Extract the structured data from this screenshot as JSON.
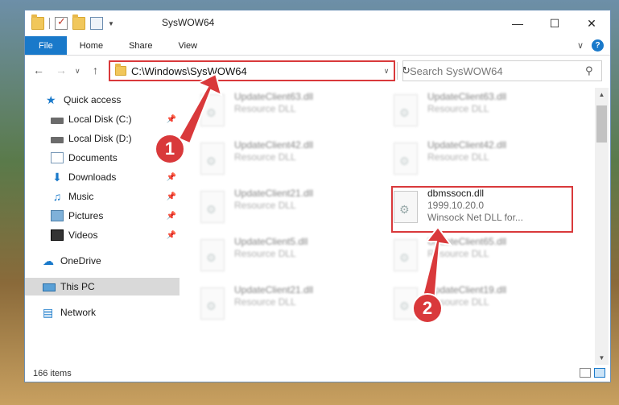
{
  "window": {
    "title": "SysWOW64"
  },
  "ribbon": {
    "tabs": [
      "File",
      "Home",
      "Share",
      "View"
    ]
  },
  "address": {
    "path": "C:\\Windows\\SysWOW64"
  },
  "search": {
    "placeholder": "Search SysWOW64"
  },
  "nav": {
    "items": [
      {
        "label": "Quick access",
        "icon": "star-icon"
      },
      {
        "label": "Local Disk (C:)",
        "icon": "drive-icon",
        "pinned": true
      },
      {
        "label": "Local Disk (D:)",
        "icon": "drive-icon"
      },
      {
        "label": "Documents",
        "icon": "documents-icon",
        "pinned": true
      },
      {
        "label": "Downloads",
        "icon": "download-icon",
        "pinned": true
      },
      {
        "label": "Music",
        "icon": "music-icon",
        "pinned": true
      },
      {
        "label": "Pictures",
        "icon": "pictures-icon",
        "pinned": true
      },
      {
        "label": "Videos",
        "icon": "videos-icon",
        "pinned": true
      },
      {
        "label": "OneDrive",
        "icon": "cloud-icon"
      },
      {
        "label": "This PC",
        "icon": "computer-icon",
        "selected": true
      },
      {
        "label": "Network",
        "icon": "network-icon"
      }
    ]
  },
  "files": [
    {
      "name": "UpdateClient63.dll",
      "meta": "Resource DLL"
    },
    {
      "name": "UpdateClient63.dll",
      "meta": "Resource DLL"
    },
    {
      "name": "UpdateClient42.dll",
      "meta": "Resource DLL"
    },
    {
      "name": "UpdateClient42.dll",
      "meta": "Resource DLL"
    },
    {
      "name": "UpdateClient21.dll",
      "meta": "Resource DLL"
    },
    {
      "name": "dbmssocn.dll",
      "meta": "1999.10.20.0",
      "meta2": "Winsock Net DLL for..."
    },
    {
      "name": "UpdateClient5.dll",
      "meta": "Resource DLL"
    },
    {
      "name": "UpdateClient65.dll",
      "meta": "Resource DLL"
    },
    {
      "name": "UpdateClient21.dll",
      "meta": "Resource DLL"
    },
    {
      "name": "UpdateClient19.dll",
      "meta": "Resource DLL"
    }
  ],
  "status": {
    "count": "166 items"
  },
  "annotations": {
    "step1": "1",
    "step2": "2"
  },
  "colors": {
    "accent": "#1979ca",
    "highlight": "#d9393b"
  }
}
